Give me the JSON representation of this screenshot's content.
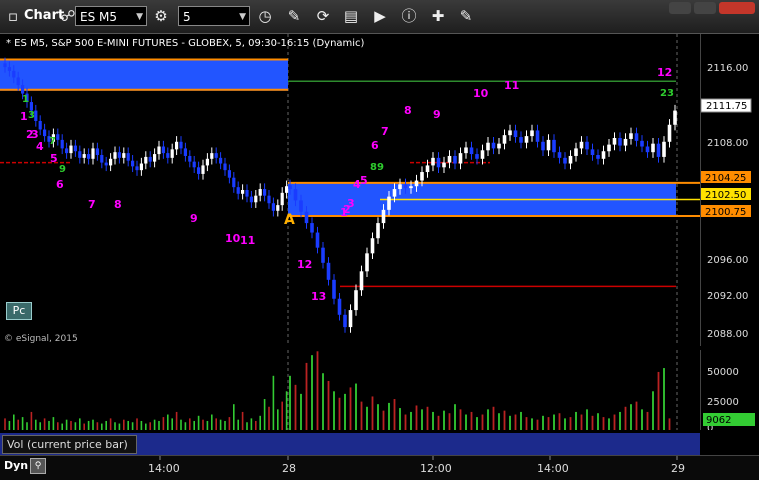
{
  "toolbar": {
    "title": "Chart",
    "symbol": "ES M5",
    "interval": "5"
  },
  "chart_title": "* ES M5, S&P 500 E-MINI FUTURES - GLOBEX, 5, 09:30-16:15 (Dynamic)",
  "copyright": "© eSignal, 2015",
  "pc_label": "Pc",
  "vol_label": "Vol (current price bar)",
  "dyn_label": "Dyn",
  "colors": {
    "up": "#ffffff",
    "down": "#1a3cff",
    "zone_blue": "#2255ff",
    "orange": "#ff8c00",
    "green_line": "#2e8b2e",
    "red_line": "#cc0000",
    "magenta": "#ff00ff"
  },
  "chart_data": {
    "type": "candlestick",
    "price_ylim": [
      2087,
      2120
    ],
    "price_ticks": [
      "2116.00",
      "2108.00",
      "2104.25",
      "2102.50",
      "2100.75",
      "2096.00",
      "2092.00",
      "2088.00"
    ],
    "last_price_label": "2111.75",
    "level_labels": {
      "upper": "2104.25",
      "middle": "2102.50",
      "lower": "2100.75"
    },
    "volume_ticks": [
      "50000",
      "25000",
      "0"
    ],
    "current_volume_label": "9062",
    "time_ticks": [
      "14:00",
      "28",
      "12:00",
      "14:00",
      "29"
    ],
    "annotation_A": "A",
    "counts": {
      "n1": "1",
      "n2": "2",
      "n3": "3",
      "n4": "4",
      "n5": "5",
      "n6": "6",
      "n7": "7",
      "n8": "8",
      "n9": "9",
      "n10": "10",
      "n11": "11",
      "n12": "12",
      "n13": "13",
      "n23": "23",
      "n89": "89"
    }
  }
}
